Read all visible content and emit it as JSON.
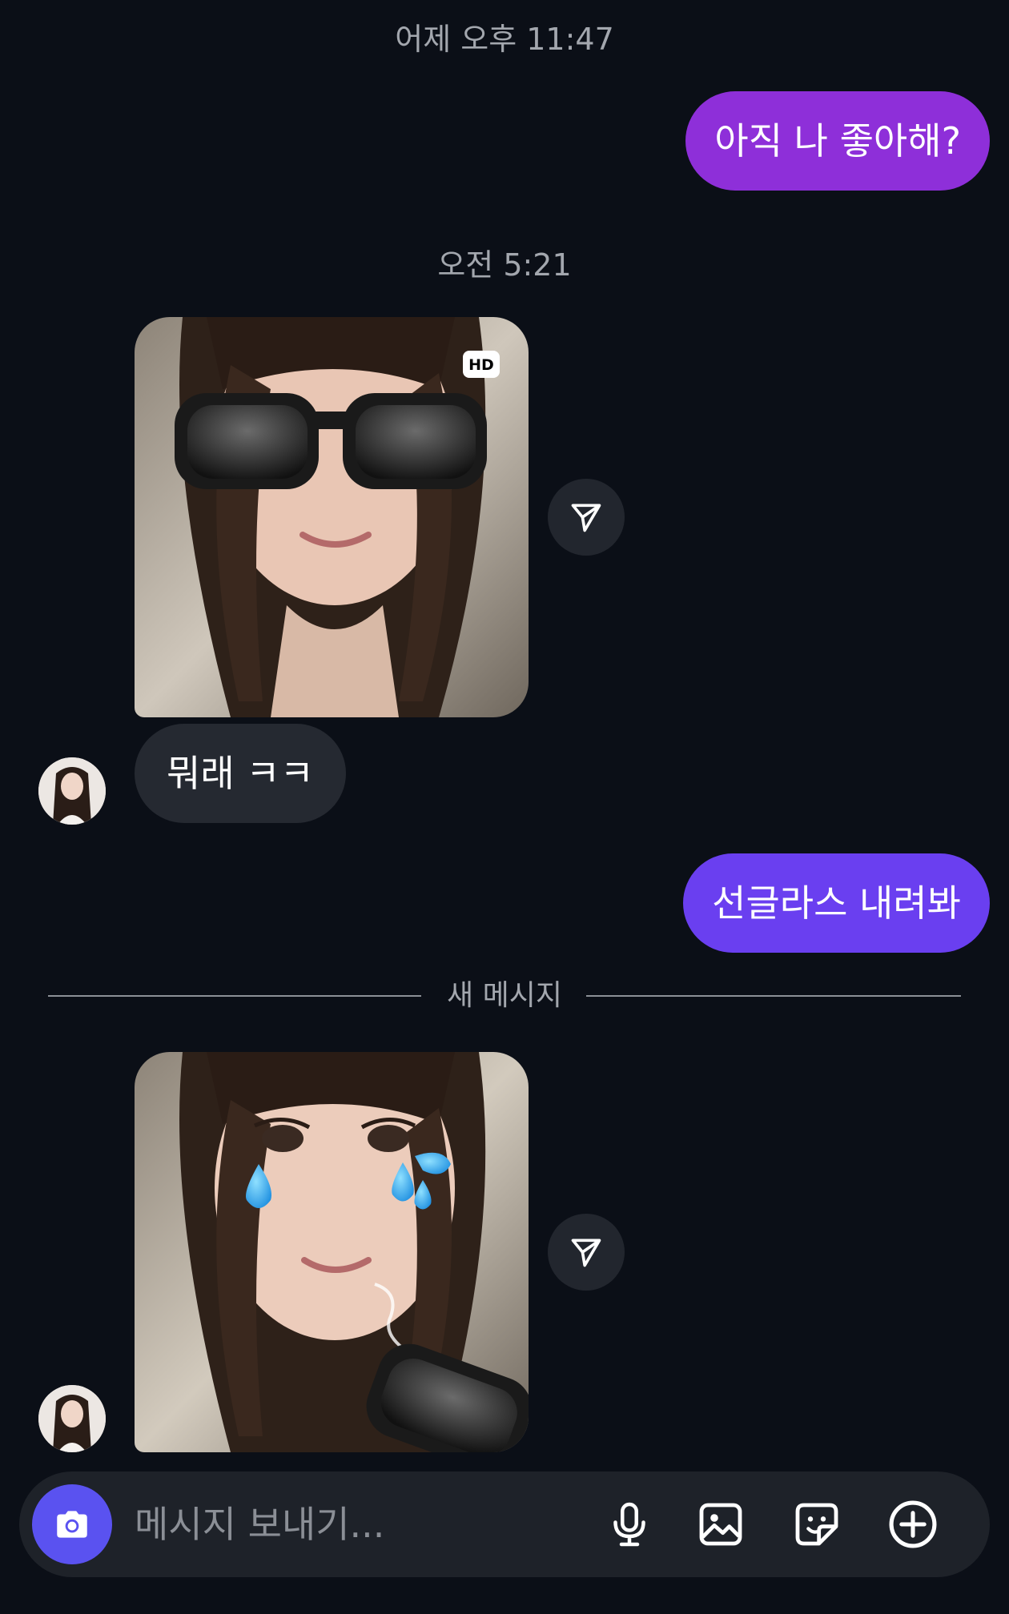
{
  "colors": {
    "background": "#0b0f17",
    "outgoing_bubble_1": "#8e2fd9",
    "outgoing_bubble_2": "#6a3ff0",
    "incoming_bubble": "#252931",
    "camera_button": "#5a52f0"
  },
  "thread": {
    "timestamp_1": "어제 오후 11:47",
    "message_1": "아직 나 좋아해?",
    "timestamp_2": "오전 5:21",
    "photo_1_badge": "HD",
    "message_2": "뭐래 ㅋㅋ",
    "message_3": "선글라스 내려봐",
    "new_messages_divider": "새 메시지"
  },
  "composer": {
    "placeholder": "메시지 보내기...",
    "icons": [
      "camera-icon",
      "microphone-icon",
      "gallery-icon",
      "sticker-icon",
      "plus-icon"
    ]
  }
}
